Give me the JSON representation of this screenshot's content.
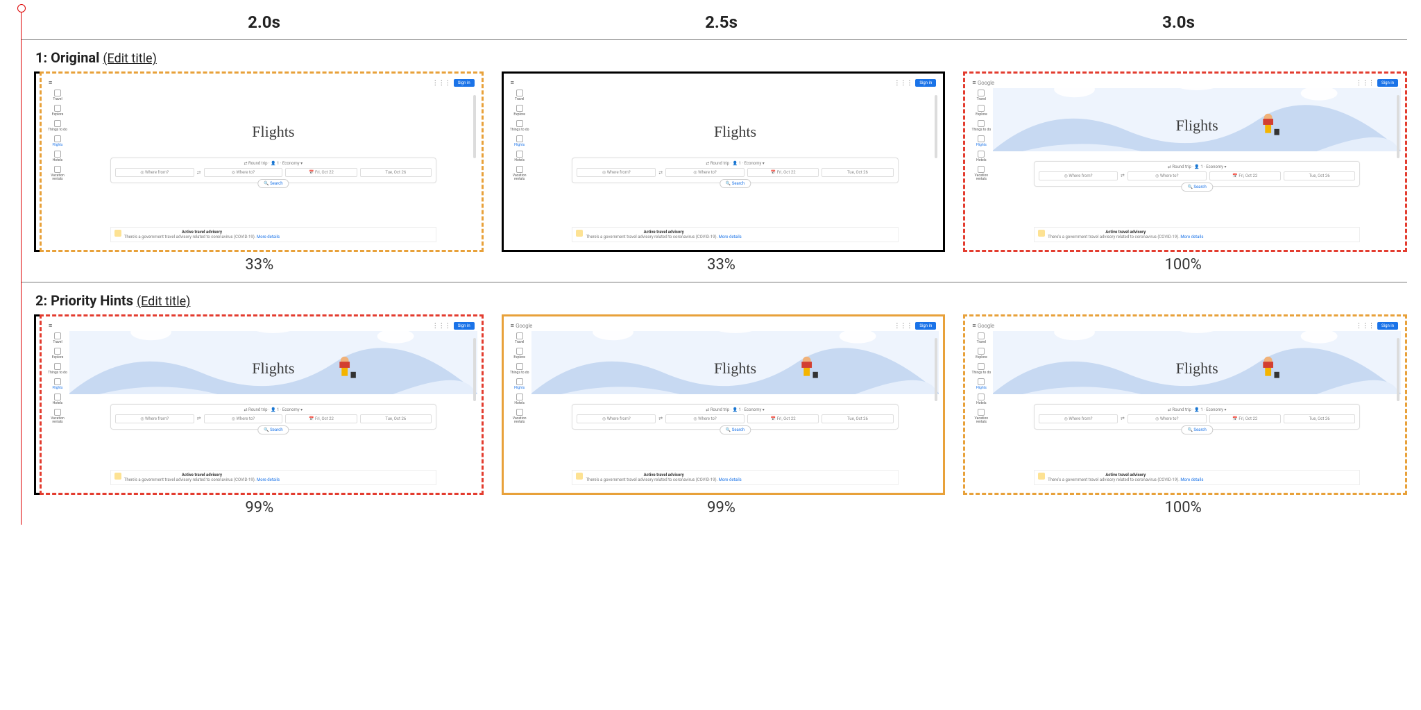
{
  "time_labels": [
    "2.0s",
    "2.5s",
    "3.0s"
  ],
  "rows": [
    {
      "num": "1:",
      "name": "Original",
      "edit": "(Edit title)",
      "frames": [
        {
          "pct": "33%",
          "has_hero": false,
          "has_logo": false,
          "border": "orange",
          "solid": false,
          "bracket": true
        },
        {
          "pct": "33%",
          "has_hero": false,
          "has_logo": false,
          "border": "black",
          "solid": true,
          "bracket": false
        },
        {
          "pct": "100%",
          "has_hero": true,
          "has_logo": true,
          "border": "red",
          "solid": false,
          "bracket": false
        }
      ]
    },
    {
      "num": "2:",
      "name": "Priority Hints",
      "edit": "(Edit title)",
      "frames": [
        {
          "pct": "99%",
          "has_hero": true,
          "has_logo": false,
          "border": "red",
          "solid": false,
          "bracket": true
        },
        {
          "pct": "99%",
          "has_hero": true,
          "has_logo": true,
          "border": "orange",
          "solid": true,
          "bracket": false
        },
        {
          "pct": "100%",
          "has_hero": true,
          "has_logo": true,
          "border": "orange",
          "solid": false,
          "bracket": false
        }
      ]
    }
  ],
  "mock": {
    "logo_text": "Google",
    "signin": "Sign in",
    "title": "Flights",
    "side_items": [
      "Travel",
      "Explore",
      "Things to do",
      "Flights",
      "Hotels",
      "Vacation rentals"
    ],
    "side_active_index": 3,
    "chips": "⇄ Round trip ·   👤 1 ·   Economy ▾",
    "from_placeholder": "Where from?",
    "to_placeholder": "Where to?",
    "date1": "Fri, Oct 22",
    "date2": "Tue, Oct 26",
    "search_label": "Search",
    "advisory_title": "Active travel advisory",
    "advisory_body": "There's a government travel advisory related to coronavirus (COVID-19).",
    "advisory_link": "More details"
  }
}
